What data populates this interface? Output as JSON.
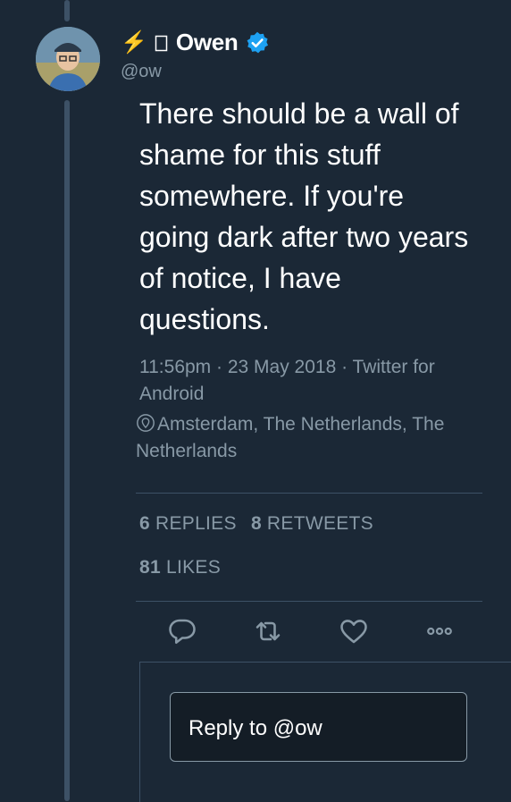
{
  "author": {
    "emoji_prefix": "⚡",
    "name": "Owen",
    "handle": "@ow",
    "verified": true
  },
  "tweet": {
    "text": "There should be a wall of shame for this stuff somewhere. If you're going dark after two years of notice, I have questions.",
    "time": "11:56pm · 23 May 2018 · Twitter for Android",
    "location": "Amsterdam, The Netherlands, The Netherlands"
  },
  "stats": {
    "replies_count": "6",
    "replies_label": "REPLIES",
    "retweets_count": "8",
    "retweets_label": "RETWEETS",
    "likes_count": "81",
    "likes_label": "LIKES"
  },
  "actions": [
    "reply-icon",
    "retweet-icon",
    "like-icon",
    "more-icon"
  ],
  "reply": {
    "placeholder": "Reply to @ow"
  },
  "colors": {
    "background": "#1b2836",
    "muted_text": "#8899a6",
    "verified": "#1da1f2",
    "divider": "#3d5166"
  }
}
